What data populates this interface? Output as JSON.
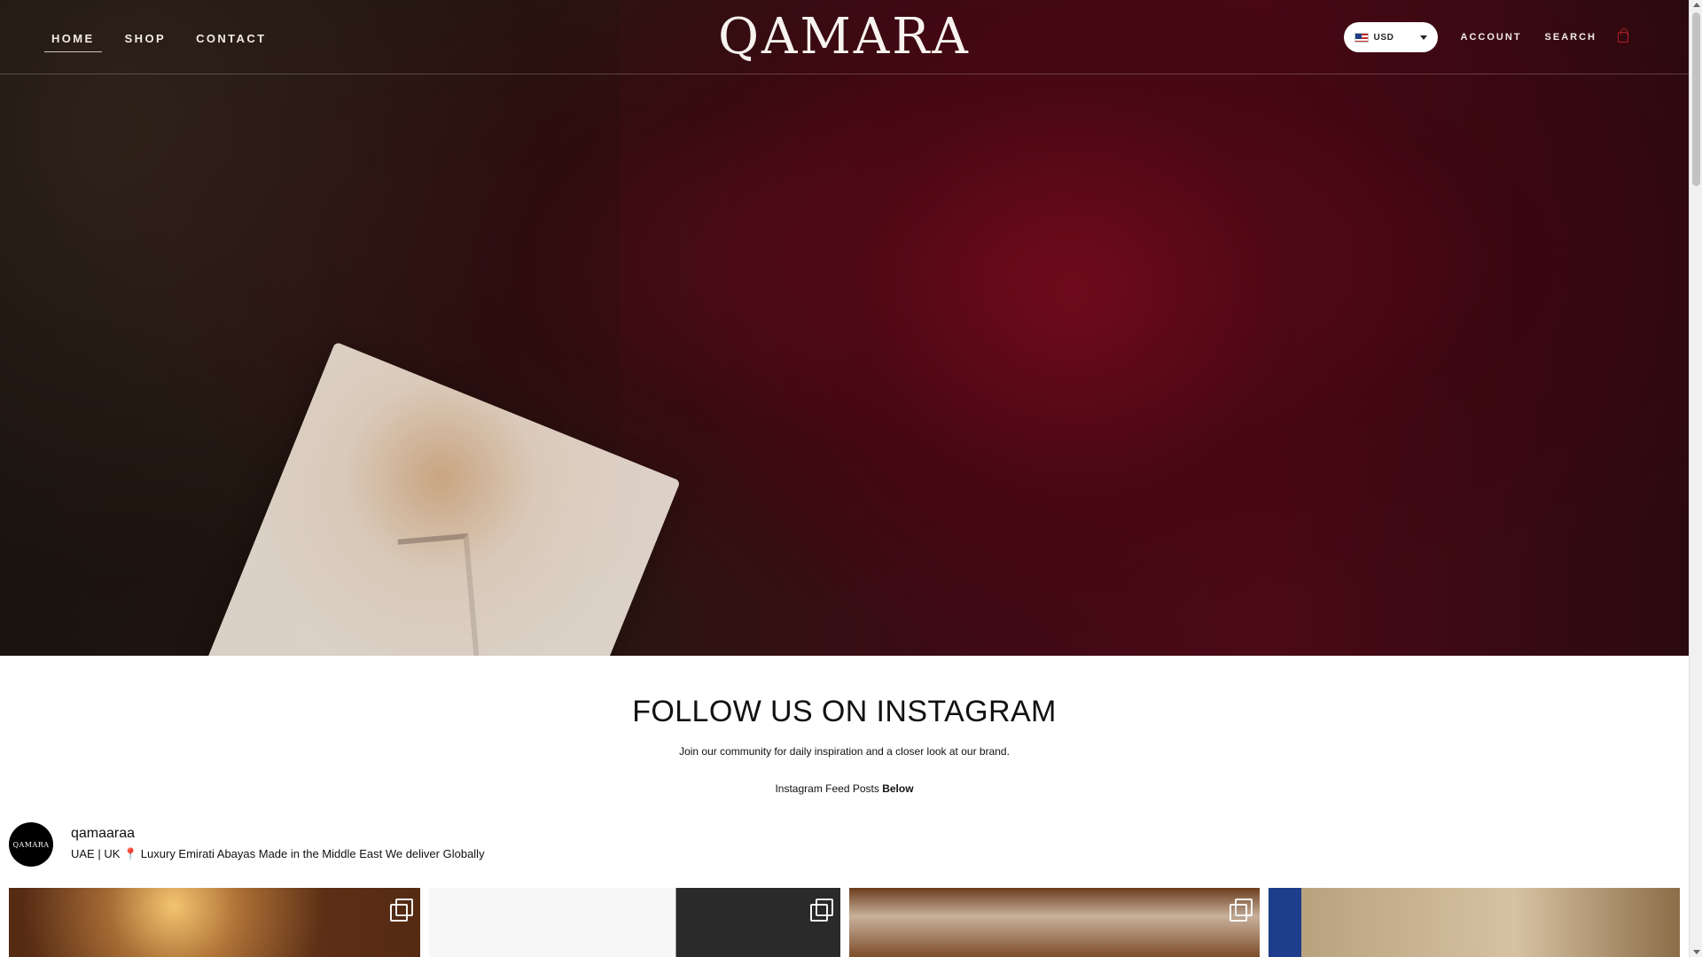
{
  "header": {
    "nav": [
      {
        "label": "HOME",
        "active": true
      },
      {
        "label": "SHOP",
        "active": false
      },
      {
        "label": "CONTACT",
        "active": false
      }
    ],
    "logo_text": "QAMARA",
    "currency": {
      "selected": "USD"
    },
    "account_label": "ACCOUNT",
    "search_label": "SEARCH",
    "icons": {
      "bag": "shopping-bag-icon",
      "caret": "chevron-down-icon",
      "flag": "us-flag-icon"
    },
    "colors": {
      "nav_text": "#f1ece7",
      "bag_accent": "#b01d2a"
    }
  },
  "instagram": {
    "title": "FOLLOW US ON INSTAGRAM",
    "subtitle": "Join our community for daily inspiration and a closer look at our brand.",
    "posts_label_prefix": "Instagram Feed Posts",
    "posts_label_bold": "Below",
    "profile": {
      "avatar_text": "QAMARA",
      "handle": "qamaaraa",
      "bio": "UAE | UK 📍 Luxury Emirati Abayas Made in the Middle East We deliver Globally"
    },
    "posts": [
      {
        "type": "multi-photo",
        "icon": "multiple-images-icon"
      },
      {
        "type": "multi-photo",
        "icon": "multiple-images-icon"
      },
      {
        "type": "multi-photo",
        "icon": "multiple-images-icon"
      },
      {
        "type": "photo"
      }
    ]
  }
}
